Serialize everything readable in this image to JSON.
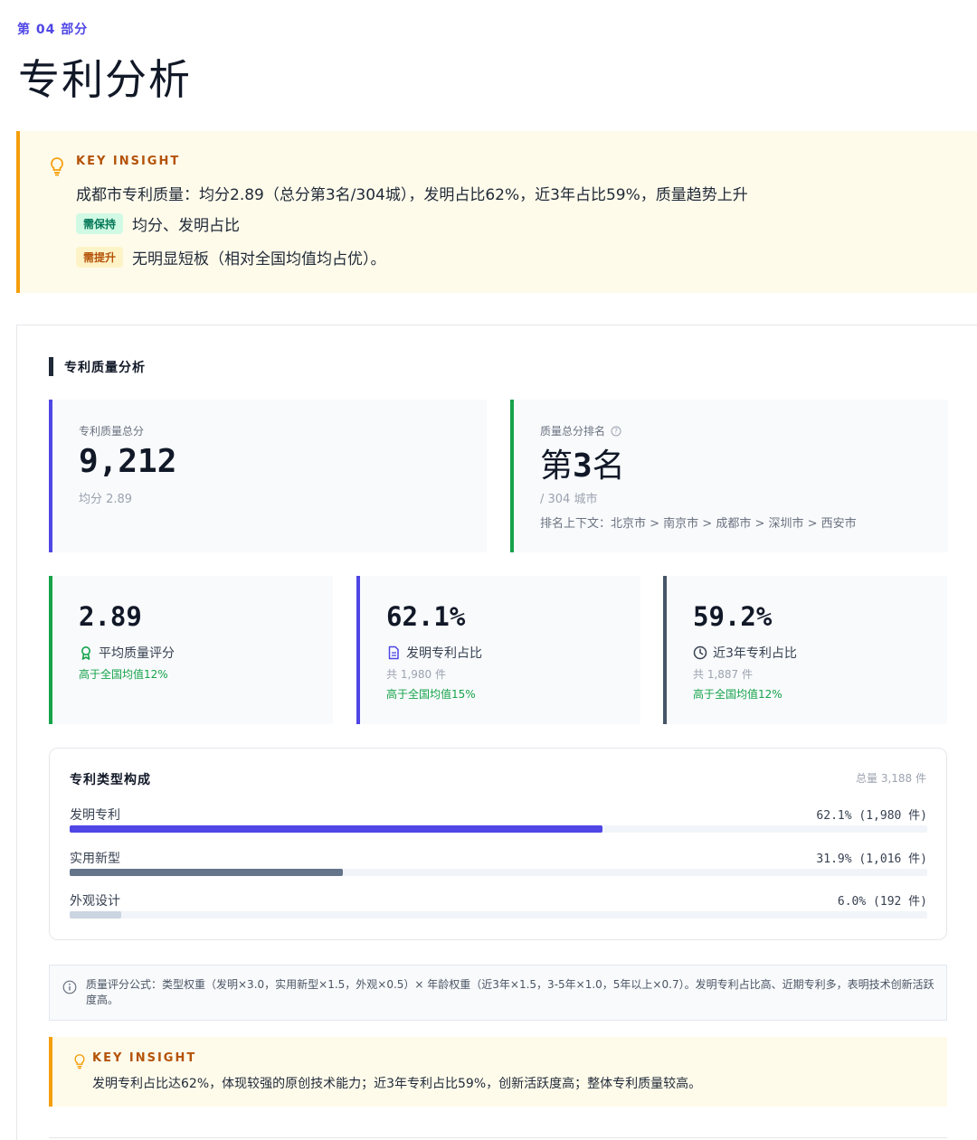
{
  "section": {
    "eyebrow": "第 04 部分",
    "title": "专利分析"
  },
  "insight_top": {
    "label": "KEY INSIGHT",
    "summary": "成都市专利质量：均分2.89（总分第3名/304城），发明占比62%，近3年占比59%，质量趋势上升",
    "keep_tag": "需保持",
    "keep_text": "均分、发明占比",
    "improve_tag": "需提升",
    "improve_text": "无明显短板（相对全国均值均占优）。"
  },
  "quality": {
    "heading": "专利质量分析",
    "total_card": {
      "caption": "专利质量总分",
      "value": "9,212",
      "sub": "均分 2.89"
    },
    "rank_card": {
      "caption": "质量总分排名",
      "help_icon": "question-circle-icon",
      "value_prefix": "第",
      "value_num": "3",
      "value_suffix": "名",
      "sub": "/ 304 城市",
      "context": "排名上下文：北京市 > 南京市 > 成都市 > 深圳市 > 西安市"
    },
    "metrics": [
      {
        "value": "2.89",
        "icon": "award-icon",
        "label": "平均质量评分",
        "count": "",
        "compare": "高于全国均值12%",
        "accent": "#16a34a"
      },
      {
        "value": "62.1%",
        "icon": "document-icon",
        "label": "发明专利占比",
        "count": "共 1,980 件",
        "compare": "高于全国均值15%",
        "accent": "#4f46e5"
      },
      {
        "value": "59.2%",
        "icon": "clock-icon",
        "label": "近3年专利占比",
        "count": "共 1,887 件",
        "compare": "高于全国均值12%",
        "accent": "#475569"
      }
    ]
  },
  "composition": {
    "title": "专利类型构成",
    "total": "总量 3,188 件",
    "rows": [
      {
        "name": "发明专利",
        "value_label": "62.1% (1,980 件)",
        "percent": 62.1,
        "color": "#4f46e5"
      },
      {
        "name": "实用新型",
        "value_label": "31.9% (1,016 件)",
        "percent": 31.9,
        "color": "#64748b"
      },
      {
        "name": "外观设计",
        "value_label": "6.0% (192 件)",
        "percent": 6.0,
        "color": "#cbd5e1"
      }
    ]
  },
  "formula": {
    "icon": "info-icon",
    "text": "质量评分公式：类型权重（发明×3.0，实用新型×1.5，外观×0.5）× 年龄权重（近3年×1.5，3-5年×1.0，5年以上×0.7）。发明专利占比高、近期专利多，表明技术创新活跃度高。"
  },
  "insight_bottom": {
    "label": "KEY INSIGHT",
    "text": "发明专利占比达62%，体现较强的原创技术能力；近3年专利占比59%，创新活跃度高；整体专利质量较高。"
  }
}
